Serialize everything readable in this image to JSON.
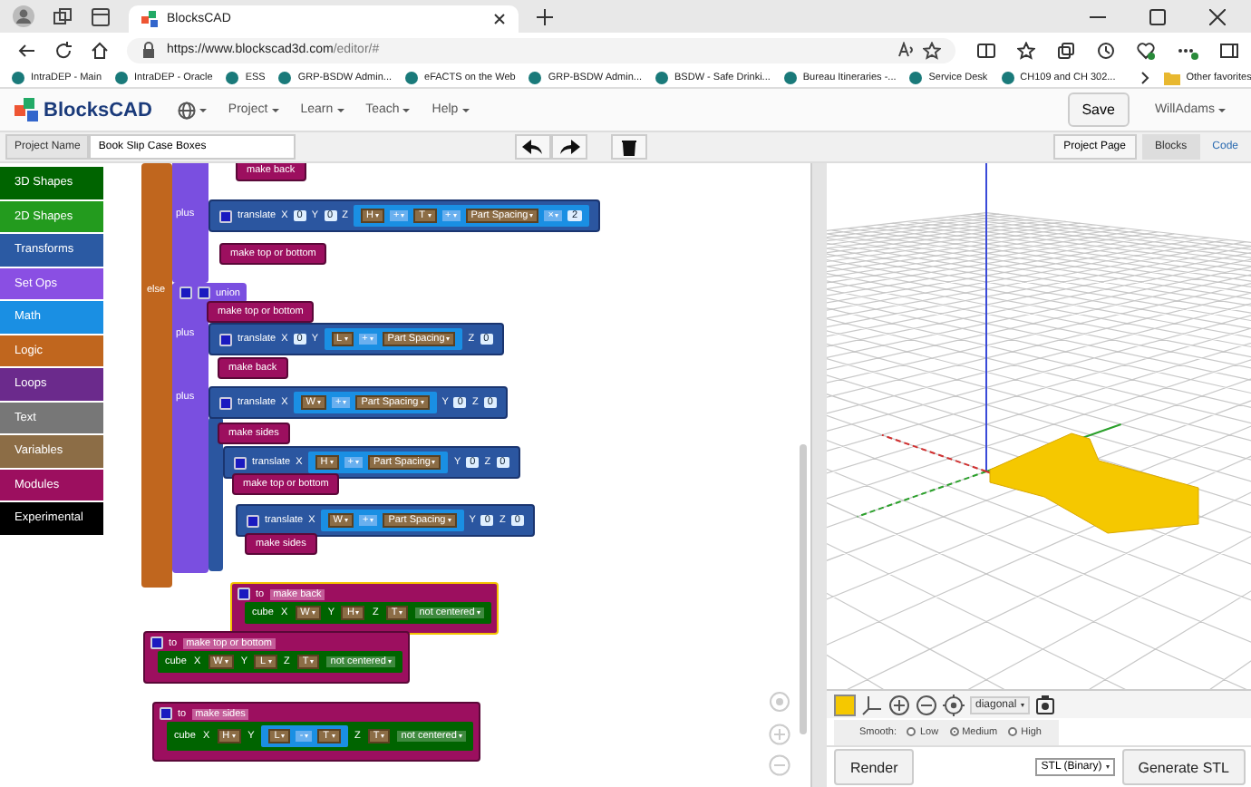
{
  "browser": {
    "tab_title": "BlocksCAD",
    "url_host": "https://www.blockscad3d.com",
    "url_path": "/editor/#",
    "bookmarks": [
      "IntraDEP - Main",
      "IntraDEP - Oracle",
      "ESS",
      "GRP-BSDW Admin...",
      "eFACTS on the Web",
      "GRP-BSDW Admin...",
      "BSDW - Safe Drinki...",
      "Bureau Itineraries -...",
      "Service Desk",
      "CH109 and CH 302..."
    ],
    "other_favorites": "Other favorites"
  },
  "navbar": {
    "logo": "BlocksCAD",
    "menus": [
      "Project",
      "Learn",
      "Teach",
      "Help"
    ],
    "save": "Save",
    "user": "WillAdams"
  },
  "toolbar": {
    "project_name_label": "Project Name",
    "project_name": "Book Slip Case Boxes",
    "project_page": "Project Page",
    "tabs": [
      {
        "label": "Blocks",
        "selected": true
      },
      {
        "label": "Code",
        "selected": false
      }
    ]
  },
  "categories": [
    {
      "label": "3D Shapes",
      "color": "#006400"
    },
    {
      "label": "2D Shapes",
      "color": "#239b1e"
    },
    {
      "label": "Transforms",
      "color": "#2b5aa3"
    },
    {
      "label": "Set Ops",
      "color": "#8a4fe3"
    },
    {
      "label": "Math",
      "color": "#1a8fe3"
    },
    {
      "label": "Logic",
      "color": "#c0661e"
    },
    {
      "label": "Loops",
      "color": "#6b2a8c"
    },
    {
      "label": "Text",
      "color": "#777777"
    },
    {
      "label": "Variables",
      "color": "#8c6d46"
    },
    {
      "label": "Modules",
      "color": "#9c0f5f"
    },
    {
      "label": "Experimental",
      "color": "#000000"
    }
  ],
  "workspace": {
    "blocks": [
      {
        "kind": "call",
        "text": "make back"
      },
      {
        "kind": "label",
        "text": "plus"
      },
      {
        "kind": "translate",
        "text": "translate",
        "parts": [
          {
            "kind": "text",
            "text": "X"
          },
          {
            "kind": "num",
            "text": "0"
          },
          {
            "kind": "text",
            "text": "Y"
          },
          {
            "kind": "num",
            "text": "0"
          },
          {
            "kind": "text",
            "text": "Z"
          },
          {
            "kind": "expr",
            "items": [
              {
                "kind": "var",
                "text": "H"
              },
              {
                "kind": "op",
                "text": "+"
              },
              {
                "kind": "var",
                "text": "T"
              },
              {
                "kind": "op",
                "text": "+"
              },
              {
                "kind": "var",
                "text": "Part Spacing"
              },
              {
                "kind": "op",
                "text": "×"
              },
              {
                "kind": "num",
                "text": "2"
              }
            ]
          }
        ]
      },
      {
        "kind": "call",
        "text": "make top or bottom"
      },
      {
        "kind": "label",
        "text": "else"
      },
      {
        "kind": "union",
        "text": "union"
      },
      {
        "kind": "call",
        "text": "make top or bottom"
      },
      {
        "kind": "label",
        "text": "plus"
      },
      {
        "kind": "translate",
        "text": "translate",
        "parts": [
          {
            "kind": "text",
            "text": "X"
          },
          {
            "kind": "num",
            "text": "0"
          },
          {
            "kind": "text",
            "text": "Y"
          },
          {
            "kind": "expr",
            "items": [
              {
                "kind": "var",
                "text": "L"
              },
              {
                "kind": "op",
                "text": "+"
              },
              {
                "kind": "var",
                "text": "Part Spacing"
              }
            ]
          },
          {
            "kind": "text",
            "text": "Z"
          },
          {
            "kind": "num",
            "text": "0"
          }
        ]
      },
      {
        "kind": "call",
        "text": "make back"
      },
      {
        "kind": "label",
        "text": "plus"
      },
      {
        "kind": "translate",
        "text": "translate",
        "parts": [
          {
            "kind": "text",
            "text": "X"
          },
          {
            "kind": "expr",
            "items": [
              {
                "kind": "var",
                "text": "W"
              },
              {
                "kind": "op",
                "text": "+"
              },
              {
                "kind": "var",
                "text": "Part Spacing"
              }
            ]
          },
          {
            "kind": "text",
            "text": "Y"
          },
          {
            "kind": "num",
            "text": "0"
          },
          {
            "kind": "text",
            "text": "Z"
          },
          {
            "kind": "num",
            "text": "0"
          }
        ]
      },
      {
        "kind": "call",
        "text": "make sides"
      },
      {
        "kind": "translate",
        "text": "translate",
        "parts": [
          {
            "kind": "text",
            "text": "X"
          },
          {
            "kind": "expr",
            "items": [
              {
                "kind": "var",
                "text": "H"
              },
              {
                "kind": "op",
                "text": "+"
              },
              {
                "kind": "var",
                "text": "Part Spacing"
              }
            ]
          },
          {
            "kind": "text",
            "text": "Y"
          },
          {
            "kind": "num",
            "text": "0"
          },
          {
            "kind": "text",
            "text": "Z"
          },
          {
            "kind": "num",
            "text": "0"
          }
        ]
      },
      {
        "kind": "call",
        "text": "make top or bottom"
      },
      {
        "kind": "translate",
        "text": "translate",
        "parts": [
          {
            "kind": "text",
            "text": "X"
          },
          {
            "kind": "expr",
            "items": [
              {
                "kind": "var",
                "text": "W"
              },
              {
                "kind": "op",
                "text": "+"
              },
              {
                "kind": "var",
                "text": "Part Spacing"
              }
            ]
          },
          {
            "kind": "text",
            "text": "Y"
          },
          {
            "kind": "num",
            "text": "0"
          },
          {
            "kind": "text",
            "text": "Z"
          },
          {
            "kind": "num",
            "text": "0"
          }
        ]
      },
      {
        "kind": "call",
        "text": "make sides"
      },
      {
        "kind": "module",
        "to": "to",
        "name": "make back",
        "selected": true,
        "cube": "cube",
        "parts": [
          {
            "kind": "text",
            "text": "X"
          },
          {
            "kind": "var",
            "text": "W"
          },
          {
            "kind": "text",
            "text": "Y"
          },
          {
            "kind": "var",
            "text": "H"
          },
          {
            "kind": "text",
            "text": "Z"
          },
          {
            "kind": "var",
            "text": "T"
          },
          {
            "kind": "dropdown",
            "text": "not centered"
          }
        ]
      },
      {
        "kind": "module",
        "to": "to",
        "name": "make top or bottom",
        "selected": false,
        "cube": "cube",
        "parts": [
          {
            "kind": "text",
            "text": "X"
          },
          {
            "kind": "var",
            "text": "W"
          },
          {
            "kind": "text",
            "text": "Y"
          },
          {
            "kind": "var",
            "text": "L"
          },
          {
            "kind": "text",
            "text": "Z"
          },
          {
            "kind": "var",
            "text": "T"
          },
          {
            "kind": "dropdown",
            "text": "not centered"
          }
        ]
      },
      {
        "kind": "module",
        "to": "to",
        "name": "make sides",
        "selected": false,
        "cube": "cube",
        "parts": [
          {
            "kind": "text",
            "text": "X"
          },
          {
            "kind": "var",
            "text": "H"
          },
          {
            "kind": "text",
            "text": "Y"
          },
          {
            "kind": "expr",
            "items": [
              {
                "kind": "var",
                "text": "L"
              },
              {
                "kind": "op",
                "text": "-"
              },
              {
                "kind": "var",
                "text": "T"
              }
            ]
          },
          {
            "kind": "text",
            "text": "Z"
          },
          {
            "kind": "var",
            "text": "T"
          },
          {
            "kind": "dropdown",
            "text": "not centered"
          }
        ]
      }
    ]
  },
  "viewer": {
    "view": "diagonal",
    "smooth_label": "Smooth:",
    "smooth": [
      {
        "label": "Low",
        "selected": false
      },
      {
        "label": "Medium",
        "selected": true
      },
      {
        "label": "High",
        "selected": false
      }
    ],
    "render": "Render",
    "format": "STL (Binary)",
    "generate": "Generate STL"
  }
}
